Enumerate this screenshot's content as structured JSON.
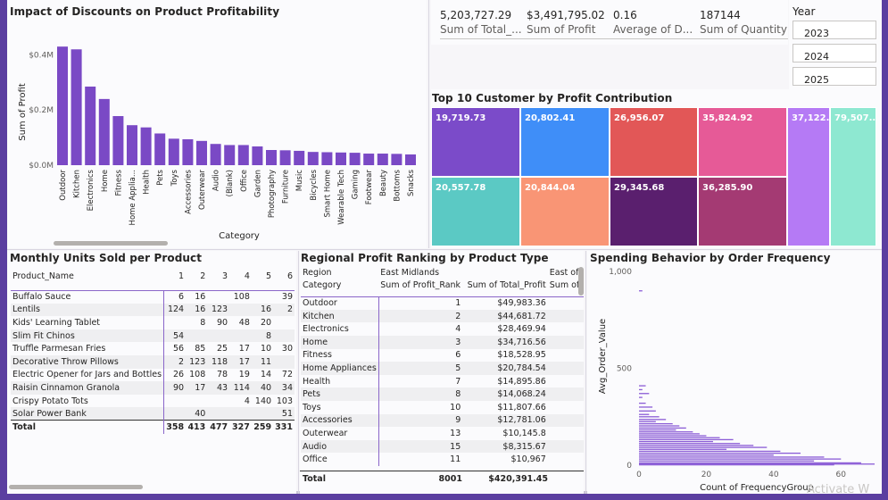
{
  "discount_chart": {
    "title": "Impact of Discounts on Product Profitability",
    "chart_data": {
      "type": "bar",
      "ylabel": "Sum of Profit",
      "xlabel": "Category",
      "yticks": [
        "$0.0M",
        "$0.2M",
        "$0.4M"
      ],
      "ylim": [
        0,
        0.45
      ],
      "color": "#7a49c5",
      "categories": [
        "Outdoor",
        "Kitchen",
        "Electronics",
        "Home",
        "Fitness",
        "Home Applia...",
        "Health",
        "Pets",
        "Toys",
        "Accessories",
        "Outerwear",
        "Audio",
        "(Blank)",
        "Office",
        "Garden",
        "Photography",
        "Furniture",
        "Music",
        "Bicycles",
        "Smart Home",
        "Wearable Tech",
        "Gaming",
        "Footwear",
        "Beauty",
        "Bottoms",
        "Snacks"
      ],
      "values": [
        0.43,
        0.42,
        0.285,
        0.24,
        0.178,
        0.145,
        0.137,
        0.115,
        0.096,
        0.094,
        0.088,
        0.077,
        0.073,
        0.073,
        0.068,
        0.055,
        0.054,
        0.052,
        0.048,
        0.047,
        0.046,
        0.045,
        0.042,
        0.042,
        0.041,
        0.039
      ]
    }
  },
  "kpis": [
    {
      "value": "5,203,727.29",
      "label": "Sum of Total_..."
    },
    {
      "value": "$3,491,795.02",
      "label": "Sum of Profit"
    },
    {
      "value": "0.16",
      "label": "Average of D..."
    },
    {
      "value": "187144",
      "label": "Sum of Quantity"
    }
  ],
  "year_slicer": {
    "title": "Year",
    "options": [
      "2023",
      "2024",
      "2025"
    ]
  },
  "treemap": {
    "title": "Top 10 Customer by Profit Contribution",
    "cells": [
      {
        "label": "19,719.73",
        "color": "#7b4bc9"
      },
      {
        "label": "20,802.41",
        "color": "#3f8ef8"
      },
      {
        "label": "26,956.07",
        "color": "#e25757"
      },
      {
        "label": "35,824.92",
        "color": "#e65a97"
      },
      {
        "label": "37,122....",
        "color": "#b57af5"
      },
      {
        "label": "79,507....",
        "color": "#8ee8d1"
      },
      {
        "label": "20,557.78",
        "color": "#5bc9c4"
      },
      {
        "label": "20,844.04",
        "color": "#f99575"
      },
      {
        "label": "29,345.68",
        "color": "#5a1f6e"
      },
      {
        "label": "36,285.90",
        "color": "#a43a73"
      }
    ]
  },
  "units_table": {
    "title": "Monthly Units Sold per Product",
    "header": [
      "Product_Name",
      "1",
      "2",
      "3",
      "4",
      "5",
      "6"
    ],
    "rows": [
      [
        "Buffalo Sauce",
        "6",
        "16",
        "",
        "108",
        "",
        "39"
      ],
      [
        "Lentils",
        "124",
        "16",
        "123",
        "",
        "16",
        "2"
      ],
      [
        "Kids' Learning Tablet",
        "",
        "8",
        "90",
        "48",
        "20",
        ""
      ],
      [
        "Slim Fit Chinos",
        "54",
        "",
        "",
        "",
        "8",
        ""
      ],
      [
        "Truffle Parmesan Fries",
        "56",
        "85",
        "25",
        "17",
        "10",
        "30"
      ],
      [
        "Decorative Throw Pillows",
        "2",
        "123",
        "118",
        "17",
        "11",
        ""
      ],
      [
        "Electric Opener for Jars and Bottles",
        "26",
        "108",
        "78",
        "19",
        "14",
        "72"
      ],
      [
        "Raisin Cinnamon Granola",
        "90",
        "17",
        "43",
        "114",
        "40",
        "34"
      ],
      [
        "Crispy Potato Tots",
        "",
        "",
        "",
        "4",
        "140",
        "103"
      ],
      [
        "Solar Power Bank",
        "",
        "40",
        "",
        "",
        "",
        "51"
      ]
    ],
    "total": [
      "Total",
      "358",
      "413",
      "477",
      "327",
      "259",
      "331"
    ]
  },
  "region_table": {
    "title": "Regional Profit Ranking by Product Type",
    "header1": [
      "Region",
      "East Midlands",
      "",
      "East of"
    ],
    "header2": [
      "Category",
      "Sum of Profit_Rank",
      "Sum of Total_Profit",
      "Sum of"
    ],
    "rows": [
      [
        "Outdoor",
        "1",
        "$49,983.36"
      ],
      [
        "Kitchen",
        "2",
        "$44,681.72"
      ],
      [
        "Electronics",
        "4",
        "$28,469.94"
      ],
      [
        "Home",
        "3",
        "$34,716.56"
      ],
      [
        "Fitness",
        "6",
        "$18,528.95"
      ],
      [
        "Home Appliances",
        "5",
        "$20,784.54"
      ],
      [
        "Health",
        "7",
        "$14,895.86"
      ],
      [
        "Pets",
        "8",
        "$14,068.24"
      ],
      [
        "Toys",
        "10",
        "$11,807.66"
      ],
      [
        "Accessories",
        "9",
        "$12,781.06"
      ],
      [
        "Outerwear",
        "13",
        "$10,145.8"
      ],
      [
        "Audio",
        "15",
        "$8,315.67"
      ],
      [
        "Office",
        "11",
        "$10,967"
      ]
    ],
    "total": [
      "Total",
      "8001",
      "$420,391.45"
    ]
  },
  "spending_chart": {
    "title": "Spending Behavior by Order Frequency",
    "chart_data": {
      "type": "bar",
      "orientation": "horizontal",
      "ylabel": "Avg_Order_Value",
      "xlabel": "Count of FrequencyGroup",
      "yticks": [
        "1,000",
        "500",
        "0"
      ],
      "xticks": [
        "0",
        "20",
        "40",
        "60"
      ],
      "xlim": [
        0,
        70
      ],
      "ylim": [
        0,
        1000
      ],
      "color": "#8b5cd6",
      "bars": [
        [
          900,
          1
        ],
        [
          410,
          2
        ],
        [
          390,
          1
        ],
        [
          370,
          3
        ],
        [
          350,
          1
        ],
        [
          320,
          2
        ],
        [
          300,
          4
        ],
        [
          280,
          5
        ],
        [
          262,
          3
        ],
        [
          250,
          6
        ],
        [
          236,
          8
        ],
        [
          225,
          5
        ],
        [
          214,
          10
        ],
        [
          203,
          12
        ],
        [
          192,
          14
        ],
        [
          182,
          11
        ],
        [
          172,
          16
        ],
        [
          162,
          18
        ],
        [
          152,
          20
        ],
        [
          142,
          24
        ],
        [
          132,
          28
        ],
        [
          122,
          22
        ],
        [
          112,
          30
        ],
        [
          102,
          34
        ],
        [
          92,
          38
        ],
        [
          82,
          26
        ],
        [
          72,
          42
        ],
        [
          62,
          48
        ],
        [
          52,
          40
        ],
        [
          42,
          55
        ],
        [
          32,
          60
        ],
        [
          22,
          52
        ],
        [
          12,
          66
        ],
        [
          6,
          70
        ],
        [
          2,
          58
        ]
      ]
    }
  },
  "watermark": "Activate W"
}
